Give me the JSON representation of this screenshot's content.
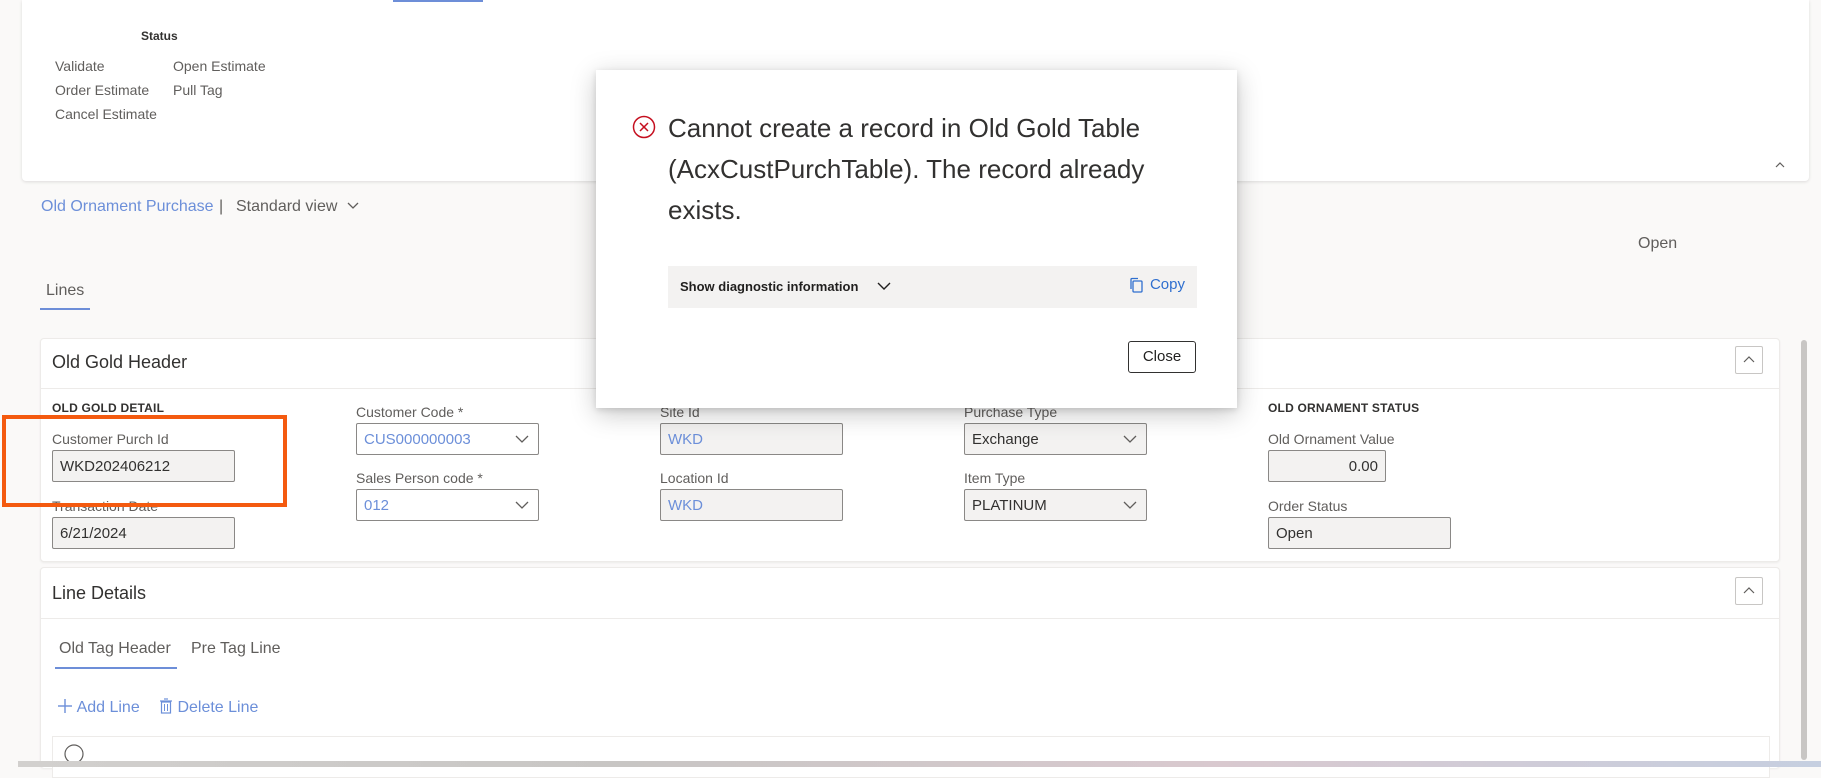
{
  "status_group": {
    "title": "Status",
    "left_items": [
      "Validate",
      "Order Estimate",
      "Cancel Estimate"
    ],
    "right_items": [
      "Open Estimate",
      "Pull Tag"
    ]
  },
  "viewbar": {
    "page_link": "Old Ornament Purchase",
    "separator": "|",
    "view_label": "Standard view",
    "record_status": "Open"
  },
  "tabs": {
    "lines": "Lines"
  },
  "header_section": {
    "title": "Old Gold Header",
    "col1": {
      "header": "OLD GOLD DETAIL",
      "customer_purch_id_label": "Customer Purch Id",
      "customer_purch_id": "WKD202406212",
      "transaction_date_label": "Transaction Date",
      "transaction_date": "6/21/2024"
    },
    "col2": {
      "customer_code_label": "Customer Code *",
      "customer_code": "CUS000000003",
      "sales_person_label": "Sales Person code *",
      "sales_person": "012"
    },
    "col3": {
      "site_id_label": "Site Id",
      "site_id": "WKD",
      "location_id_label": "Location Id",
      "location_id": "WKD"
    },
    "col4": {
      "purchase_type_label": "Purchase Type",
      "purchase_type": "Exchange",
      "item_type_label": "Item Type",
      "item_type": "PLATINUM"
    },
    "col5": {
      "header": "OLD ORNAMENT STATUS",
      "ornament_value_label": "Old Ornament Value",
      "ornament_value": "0.00",
      "order_status_label": "Order Status",
      "order_status": "Open"
    }
  },
  "line_section": {
    "title": "Line Details",
    "tabs": [
      "Old Tag Header",
      "Pre Tag Line"
    ],
    "add_line": "Add Line",
    "delete_line": "Delete Line"
  },
  "dialog": {
    "message": "Cannot create a record in Old Gold Table (AcxCustPurchTable). The record already exists.",
    "diagnostic_label": "Show diagnostic information",
    "copy_label": "Copy",
    "close_label": "Close"
  },
  "colors": {
    "accent": "#6d8ed8",
    "highlight": "#f45a0f",
    "error": "#c50f1f",
    "link": "#2f6fcf"
  }
}
